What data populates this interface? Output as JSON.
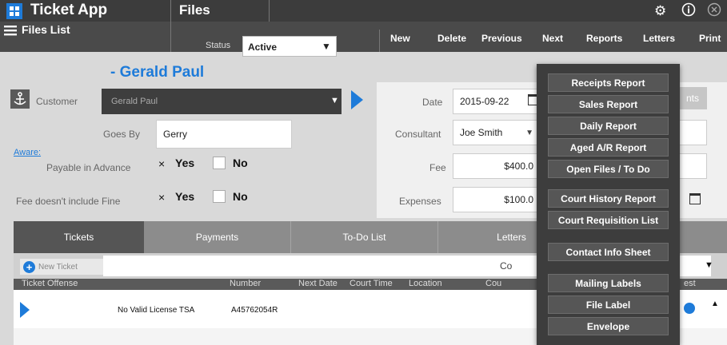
{
  "app": {
    "title": "Ticket App",
    "section": "Files"
  },
  "sidebar_toggle": {
    "label": "Files List"
  },
  "status": {
    "label": "Status",
    "value": "Active"
  },
  "toolbar": {
    "new": "New",
    "delete": "Delete",
    "previous": "Previous",
    "next": "Next",
    "reports": "Reports",
    "letters": "Letters",
    "print": "Print"
  },
  "customer": {
    "heading": "- Gerald Paul",
    "label": "Customer",
    "value": "Gerald Paul"
  },
  "goes_by": {
    "label": "Goes By",
    "value": "Gerry"
  },
  "aware": {
    "label": "Aware:"
  },
  "payable": {
    "label": "Payable in Advance",
    "yes_mark": "×",
    "yes": "Yes",
    "no": "No"
  },
  "fee_fine": {
    "label": "Fee doesn't include Fine",
    "yes_mark": "×",
    "yes": "Yes",
    "no": "No"
  },
  "date": {
    "label": "Date",
    "value": "2015-09-22"
  },
  "consultant": {
    "label": "Consultant",
    "value": "Joe Smith"
  },
  "fee": {
    "label": "Fee",
    "value": "$400.0"
  },
  "expenses": {
    "label": "Expenses",
    "value": "$100.0"
  },
  "hidden_button": {
    "label": "nts"
  },
  "tabs": [
    "Tickets",
    "Payments",
    "To-Do List",
    "Letters"
  ],
  "table": {
    "new_ticket": "New Ticket",
    "filter_partial": "Co",
    "headers": {
      "offense": "Ticket Offense",
      "number": "Number",
      "next_date": "Next Date",
      "court_time": "Court Time",
      "location": "Location",
      "court": "Cou",
      "last": "est"
    },
    "rows": [
      {
        "offense": "No Valid License TSA",
        "number": "A45762054R"
      }
    ]
  },
  "reports_menu": {
    "items": [
      "Receipts Report",
      "Sales Report",
      "Daily Report",
      "Aged A/R Report",
      "Open Files / To Do",
      "Court History Report",
      "Court Requisition List",
      "Contact Info Sheet",
      "Mailing Labels",
      "File Label",
      "Envelope"
    ]
  },
  "colors": {
    "accent": "#1e7bd9",
    "topbar": "#3c3c3c"
  }
}
